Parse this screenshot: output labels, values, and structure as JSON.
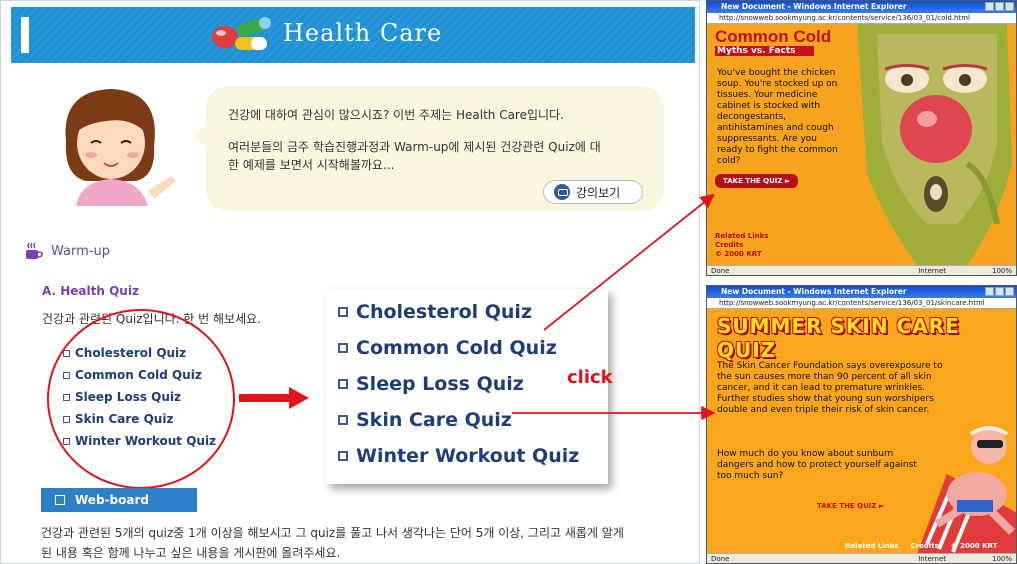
{
  "header": {
    "title": "Health Care"
  },
  "bubble": {
    "line1": "건강에 대하여 관심이 많으시죠? 이번 주제는 Health Care입니다.",
    "line2": "여러분들의 금주 학습진행과정과 Warm-up에 제시된 건강관련 Quiz에 대",
    "line3": "한 예제를 보면서 시작해볼까요...",
    "lecture_button": "강의보기"
  },
  "warmup": {
    "label": "Warm-up"
  },
  "quiz_section": {
    "title": "A. Health Quiz",
    "description": "건강과 관련된 Quiz입니다. 한 번 해보세요.",
    "items": [
      "Cholesterol Quiz",
      "Common Cold Quiz",
      "Sleep Loss Quiz",
      "Skin Care Quiz",
      "Winter Workout Quiz"
    ]
  },
  "annotation": {
    "click": "click"
  },
  "webboard": {
    "label": "Web-board",
    "text1": "건강과 관련된 5개의 quiz중 1개 이상을 해보시고 그 quiz를 풀고 나서 생각나는 단어 5개 이상, 그리고 새롭게 알게",
    "text2": "된 내용 혹은 함께 나누고 싶은 내용을 게시판에 올려주세요."
  },
  "window_cold": {
    "title_bar": "New Document - Windows Internet Explorer",
    "address": "http://snowweb.sookmyung.ac.kr/contents/service/136/03_01/cold.html",
    "heading": "Common Cold",
    "subheading": "Myths vs. Facts",
    "body": "You've bought the chicken soup. You're stocked up on tissues. Your medicine cabinet is stocked with decongestants, antihistamines and cough suppressants. Are you ready to fight the common cold?",
    "quiz_button": "TAKE THE QUIZ ►",
    "links_1": "Related Links",
    "links_2": "Credits",
    "links_3": "© 2000 KRT",
    "status_done": "Done",
    "status_zone": "Internet",
    "status_zoom": "100%"
  },
  "window_skin": {
    "title_bar": "New Document - Windows Internet Explorer",
    "address": "http://snowweb.sookmyung.ac.kr/contents/service/136/03_01/skincare.html",
    "heading": "SUMMER SKIN CARE QUIZ",
    "para1": "The Skin Cancer Foundation says overexposure to the sun causes more than 90 percent of all skin cancer, and it can lead to premature wrinkles. Further studies show that young sun worshipers double and even triple their risk of skin cancer.",
    "para2": "How much do you know about sunburn dangers and how to protect yourself against too much sun?",
    "quiz_button": "TAKE THE QUIZ ►",
    "foot_links": "Related Links",
    "foot_credits": "Credits",
    "foot_copy": "© 2000 KRT",
    "status_done": "Done",
    "status_zone": "Internet",
    "status_zoom": "100%"
  },
  "colors": {
    "header_blue": "#1f92d6",
    "accent_red": "#e0151b",
    "quiz_navy": "#1e3d7a",
    "purple": "#7b3fb3"
  }
}
